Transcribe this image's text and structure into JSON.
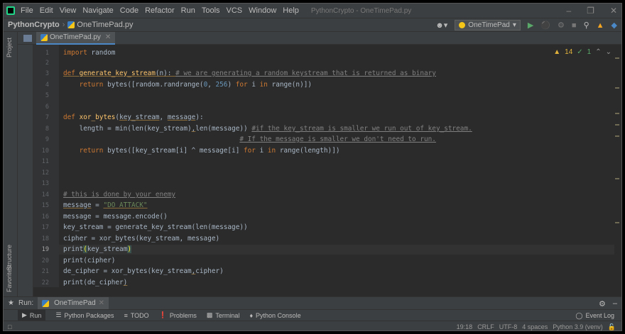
{
  "titlebar": {
    "menu": [
      "File",
      "Edit",
      "View",
      "Navigate",
      "Code",
      "Refactor",
      "Run",
      "Tools",
      "VCS",
      "Window",
      "Help"
    ],
    "window_title": "PythonCrypto - OneTimePad.py"
  },
  "navbar": {
    "project": "PythonCrypto",
    "file": "OneTimePad.py",
    "run_config": "OneTimePad"
  },
  "left_strip": {
    "project_label": "Project",
    "structure_label": "Structure",
    "favorites_label": "Favorites"
  },
  "editor_tab": {
    "label": "OneTimePad.py"
  },
  "inspections": {
    "warnings": "14",
    "ok": "1"
  },
  "code": {
    "current_line": 19,
    "line_numbers": [
      "1",
      "2",
      "3",
      "4",
      "5",
      "6",
      "7",
      "8",
      "9",
      "10",
      "11",
      "12",
      "13",
      "14",
      "15",
      "16",
      "17",
      "18",
      "19",
      "20",
      "21",
      "22"
    ]
  },
  "run_window": {
    "label": "Run:",
    "tab": "OneTimePad"
  },
  "tool_windows": {
    "run": "Run",
    "packages": "Python Packages",
    "todo": "TODO",
    "problems": "Problems",
    "terminal": "Terminal",
    "console": "Python Console",
    "event_log": "Event Log"
  },
  "status": {
    "position": "19:18",
    "line_sep": "CRLF",
    "encoding": "UTF-8",
    "indent": "4 spaces",
    "interpreter": "Python 3.9 (venv)"
  },
  "colors": {
    "keyword": "#cc7832",
    "function": "#ffc66d",
    "number": "#6897bb",
    "string": "#6a8759",
    "comment": "#808080",
    "text": "#a9b7c6"
  }
}
